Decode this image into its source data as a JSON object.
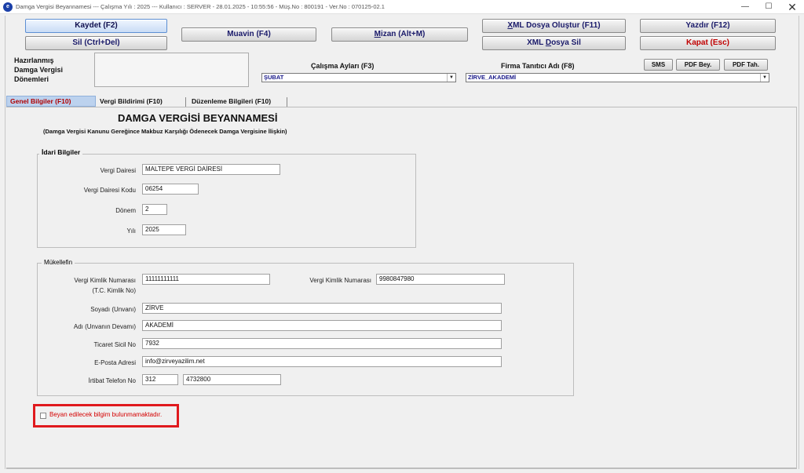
{
  "titlebar": {
    "icon_letter": "e",
    "text": "Damga Vergisi Beyannamesi  ---  Çalışma Yılı : 2025  ---  Kullanıcı : SERVER - 28.01.2025 - 10:55:56 - Müş.No : 800191 - Ver.No : 070125-02.1",
    "minimize": "—",
    "maximize": "☐",
    "close": "✕"
  },
  "toolbar": {
    "save": "Kaydet (F2)",
    "delete": "Sil (Ctrl+Del)",
    "muavin": "Muavin (F4)",
    "mizan_prefix": "M",
    "mizan_rest": "izan (Alt+M)",
    "xml_create_prefix": "X",
    "xml_create_rest": "ML Dosya Oluştur (F11)",
    "xml_delete_pre": "XML ",
    "xml_delete_u": "D",
    "xml_delete_post": "osya Sil",
    "print": "Yazdır (F12)",
    "close": "Kapat (Esc)",
    "sms": "SMS",
    "pdf_bey": "PDF Bey.",
    "pdf_tah": "PDF Tah."
  },
  "prepared": {
    "line1": "Hazırlanmış",
    "line2": "Damga Vergisi",
    "line3": "Dönemleri"
  },
  "work_months": {
    "label": "Çalışma Ayları (F3)",
    "selected": "ŞUBAT"
  },
  "company": {
    "label": "Firma Tanıtıcı Adı (F8)",
    "selected": "ZİRVE_AKADEMİ"
  },
  "tabs": [
    {
      "label": "Genel Bilgiler (F10)"
    },
    {
      "label": "Vergi Bildirimi (F10)"
    },
    {
      "label": "Düzenleme Bilgileri (F10)"
    }
  ],
  "form": {
    "title": "DAMGA VERGİSİ BEYANNAMESİ",
    "subtitle": "(Damga Vergisi Kanunu Gereğince Makbuz Karşılığı Ödenecek Damga Vergisine İlişkin)"
  },
  "idari": {
    "title": "İdari Bilgiler",
    "tax_office_label": "Vergi Dairesi",
    "tax_office": "MALTEPE VERGİ DAİRESİ",
    "tax_office_code_label": "Vergi Dairesi Kodu",
    "tax_office_code": "06254",
    "period_label": "Dönem",
    "period": "2",
    "year_label": "Yılı",
    "year": "2025"
  },
  "mukellef": {
    "title": "Mükellefin",
    "tckn_label1": "Vergi Kimlik Numarası",
    "tckn_label2": "(T.C. Kimlik No)",
    "tckn": "11111111111",
    "vkn_label": "Vergi Kimlik Numarası",
    "vkn": "9980847980",
    "surname_label": "Soyadı (Unvanı)",
    "surname": "ZİRVE",
    "name_label": "Adı (Unvanın Devamı)",
    "name": "AKADEMİ",
    "trade_reg_label": "Ticaret Sicil No",
    "trade_reg": "7932",
    "email_label": "E-Posta Adresi",
    "email": "info@zirveyazilim.net",
    "phone_label": "İrtibat Telefon No",
    "phone_area": "312",
    "phone_number": "4732800"
  },
  "notice": {
    "text": "Beyan edilecek bilgim bulunmamaktadır."
  }
}
